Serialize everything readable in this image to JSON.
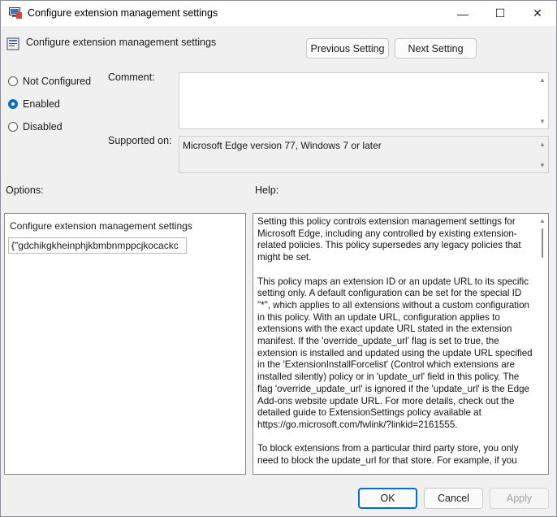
{
  "window": {
    "title": "Configure extension management settings",
    "header_title": "Configure extension management settings",
    "controls": {
      "minimize": "—",
      "maximize": "☐",
      "close": "✕"
    }
  },
  "nav": {
    "previous": "Previous Setting",
    "next": "Next Setting"
  },
  "state": {
    "options": [
      "Not Configured",
      "Enabled",
      "Disabled"
    ],
    "selected": "Enabled"
  },
  "labels": {
    "comment": "Comment:",
    "supported_on": "Supported on:",
    "options": "Options:",
    "help": "Help:"
  },
  "supported_on_value": "Microsoft Edge version 77, Windows 7 or later",
  "options_panel": {
    "field_label": "Configure extension management settings",
    "field_value": "{\"gdchikgkheinphjkbmbnmppcjkocackc"
  },
  "help_text": "Setting this policy controls extension management settings for Microsoft Edge, including any controlled by existing extension-related policies. This policy supersedes any legacy policies that might be set.\n\nThis policy maps an extension ID or an update URL to its specific setting only. A default configuration can be set for the special ID \"*\", which applies to all extensions without a custom configuration in this policy. With an update URL, configuration applies to extensions with the exact update URL stated in the extension manifest. If the 'override_update_url' flag is set to true, the extension is installed and updated using the update URL specified in the 'ExtensionInstallForcelist' (Control which extensions are installed silently) policy or in 'update_url' field in this policy. The flag 'override_update_url' is ignored if the 'update_url' is the Edge Add-ons website update URL. For more details, check out the detailed guide to ExtensionSettings policy available at https://go.microsoft.com/fwlink/?linkid=2161555.\n\nTo block extensions from a particular third party store, you only need to block the update_url for that store. For example, if you",
  "footer": {
    "ok": "OK",
    "cancel": "Cancel",
    "apply": "Apply"
  },
  "colors": {
    "accent": "#0f6cbd"
  }
}
